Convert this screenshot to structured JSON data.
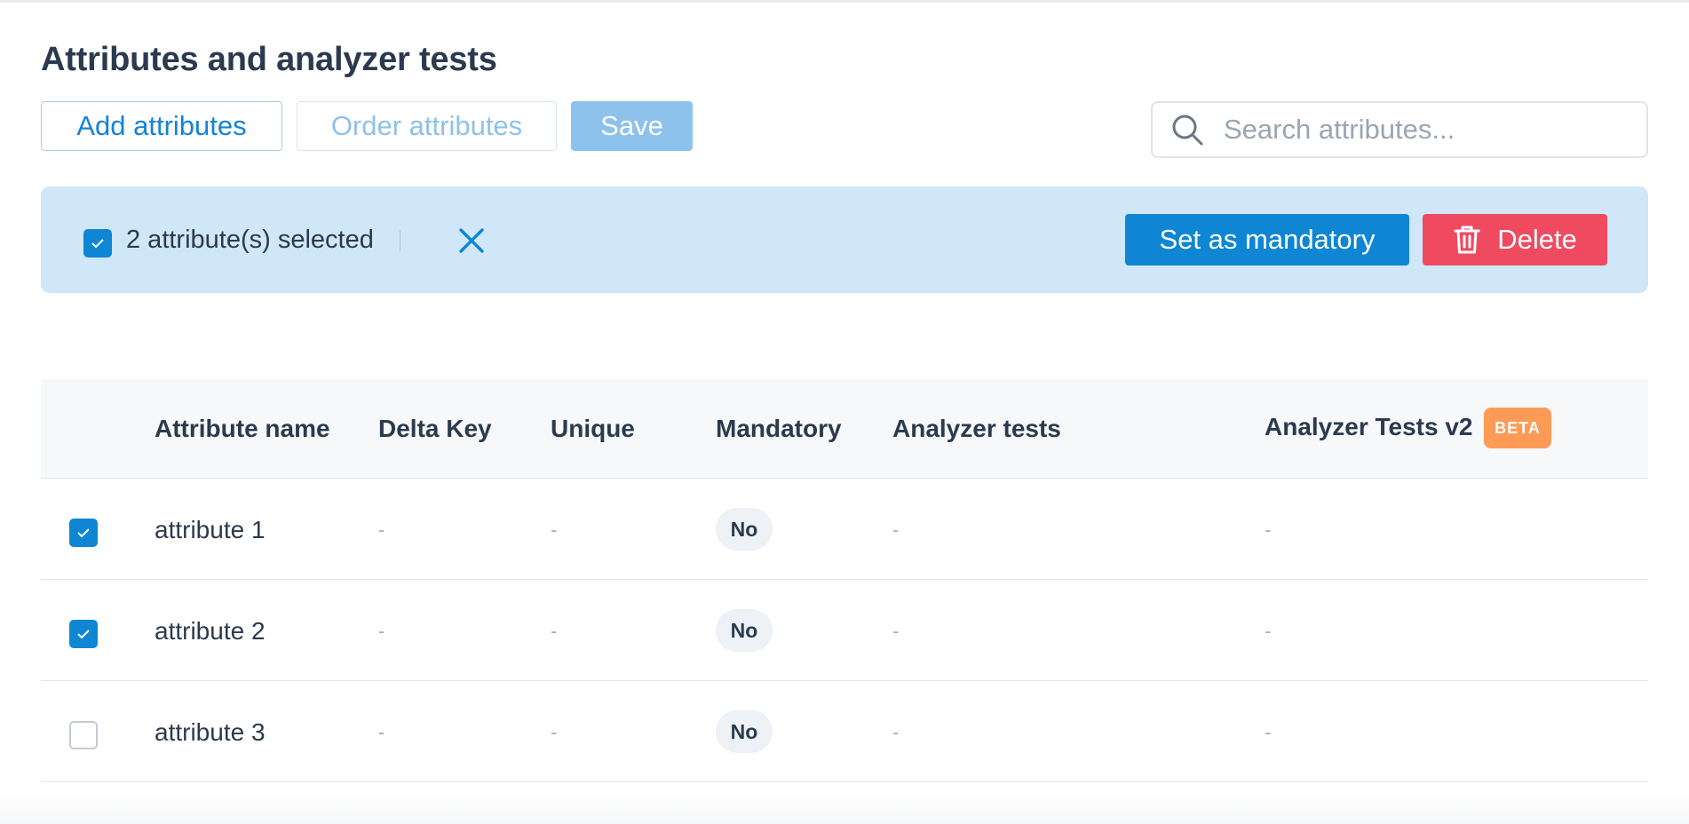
{
  "page": {
    "title": "Attributes and analyzer tests"
  },
  "toolbar": {
    "add_label": "Add attributes",
    "order_label": "Order attributes",
    "save_label": "Save"
  },
  "search": {
    "placeholder": "Search attributes...",
    "value": "",
    "icon": "search-icon"
  },
  "selection_bar": {
    "text": "2 attribute(s) selected",
    "all_checked": true,
    "clear_icon": "close-icon",
    "mandatory_label": "Set as mandatory",
    "delete_label": "Delete",
    "delete_icon": "trash-icon"
  },
  "table": {
    "headers": {
      "name": "Attribute name",
      "delta_key": "Delta Key",
      "unique": "Unique",
      "mandatory": "Mandatory",
      "analyzer_tests": "Analyzer tests",
      "analyzer_tests_v2": "Analyzer Tests v2",
      "beta_badge": "BETA"
    },
    "rows": [
      {
        "checked": true,
        "name": "attribute 1",
        "delta_key": "-",
        "unique": "-",
        "mandatory": "No",
        "analyzer_tests": "-",
        "analyzer_tests_v2": "-"
      },
      {
        "checked": true,
        "name": "attribute 2",
        "delta_key": "-",
        "unique": "-",
        "mandatory": "No",
        "analyzer_tests": "-",
        "analyzer_tests_v2": "-"
      },
      {
        "checked": false,
        "name": "attribute 3",
        "delta_key": "-",
        "unique": "-",
        "mandatory": "No",
        "analyzer_tests": "-",
        "analyzer_tests_v2": "-"
      }
    ]
  },
  "colors": {
    "primary": "#0e86d4",
    "danger": "#ef4a60",
    "selection_bg": "#cfe7f8",
    "beta": "#fd9a55",
    "text": "#2b3a4e"
  }
}
